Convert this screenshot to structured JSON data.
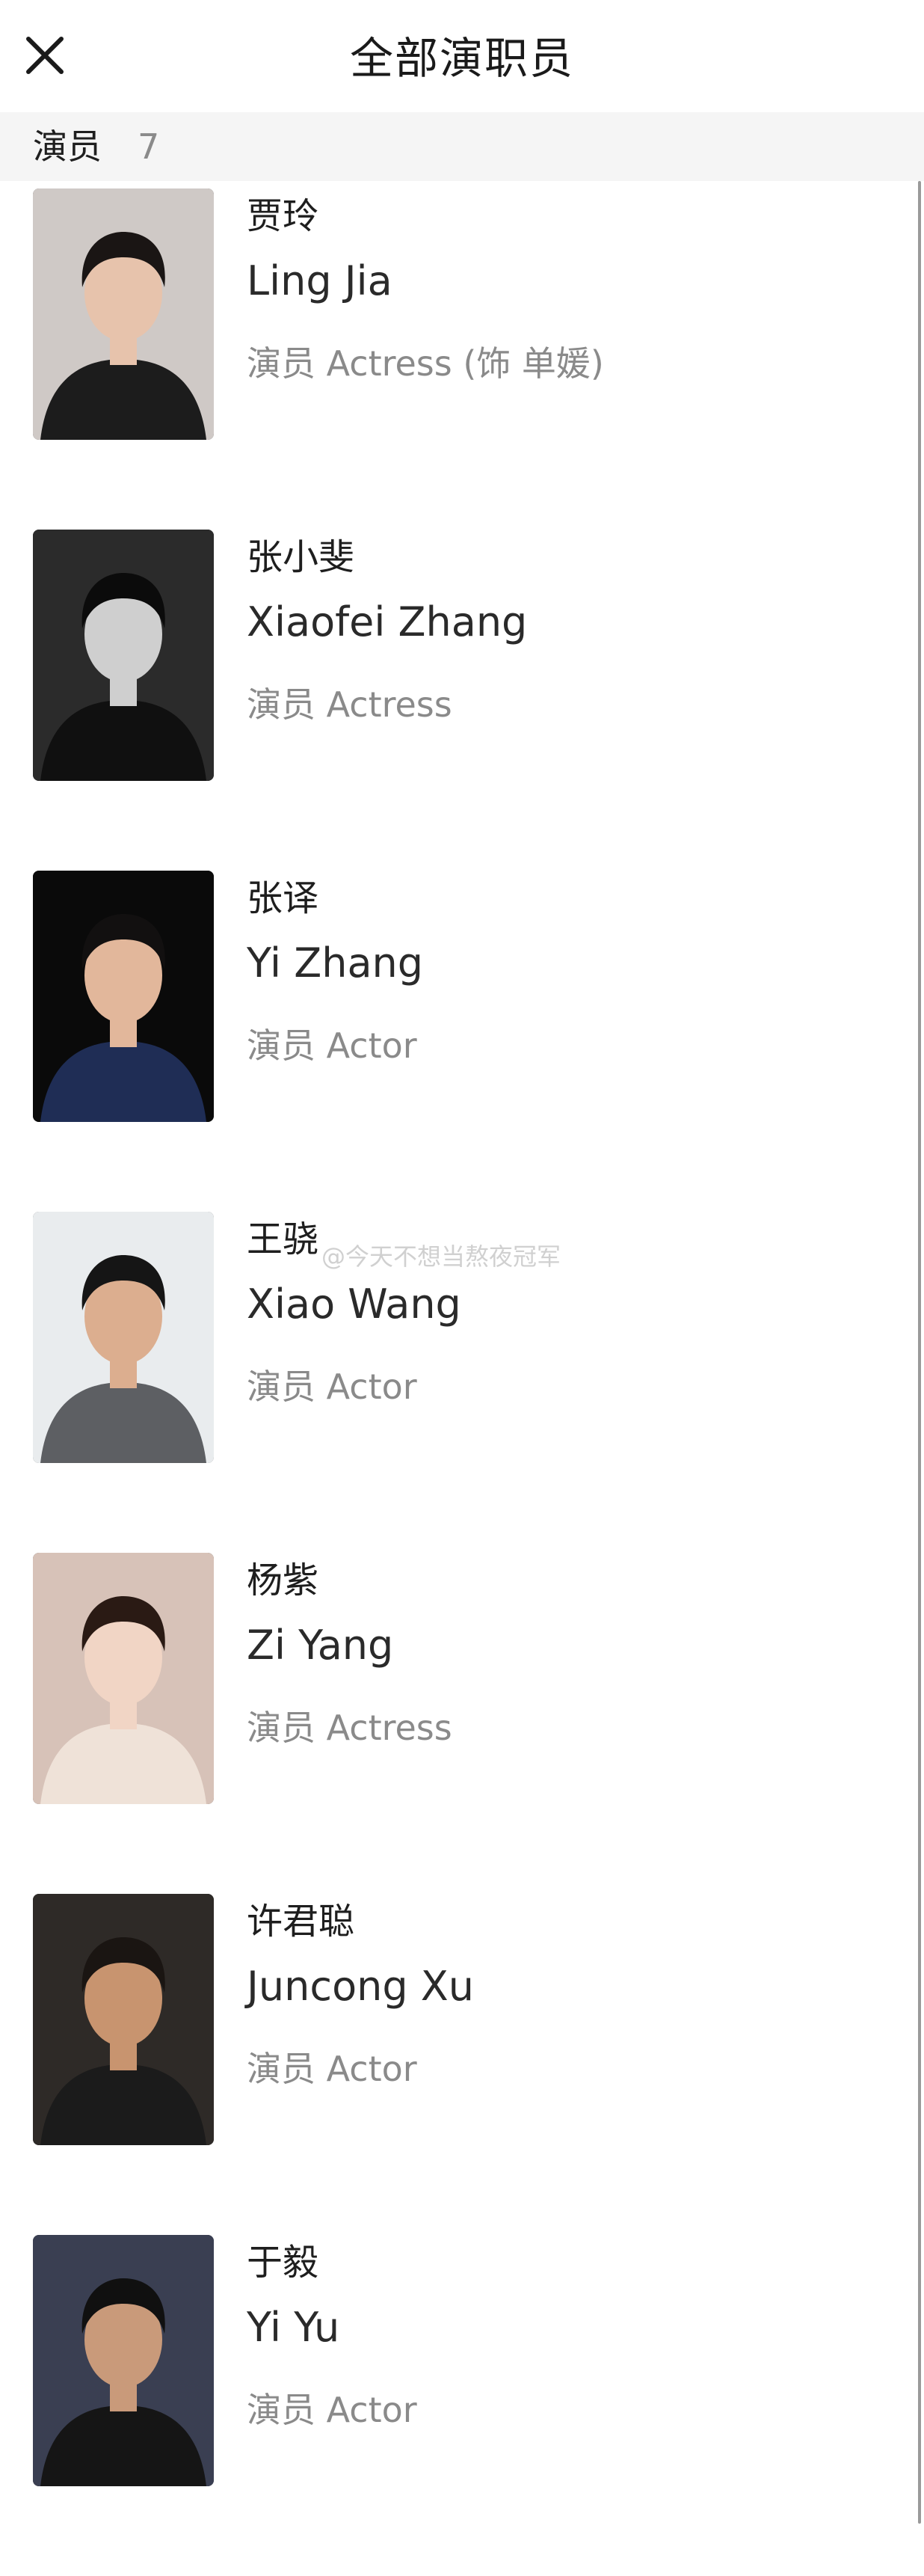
{
  "header": {
    "close_icon": "close-icon",
    "title": "全部演职员"
  },
  "section": {
    "label": "演员",
    "count": "7"
  },
  "cast": [
    {
      "cn": "贾玲",
      "en": "Ling Jia",
      "role": "演员 Actress (饰 单媛)",
      "bg": "#cfc9c6",
      "cloth": "#1c1c1c",
      "skin": "#e7c3ac",
      "hair": "#1a1514"
    },
    {
      "cn": "张小斐",
      "en": "Xiaofei Zhang",
      "role": "演员 Actress",
      "bg": "#2b2b2b",
      "cloth": "#101010",
      "skin": "#cfcfcf",
      "hair": "#0b0b0b"
    },
    {
      "cn": "张译",
      "en": "Yi Zhang",
      "role": "演员 Actor",
      "bg": "#0a0a0a",
      "cloth": "#1f2d55",
      "skin": "#e2b79b",
      "hair": "#121010"
    },
    {
      "cn": "王骁",
      "en": "Xiao Wang",
      "role": "演员 Actor",
      "bg": "#e9ecee",
      "cloth": "#5d5f63",
      "skin": "#dcae8f",
      "hair": "#151515"
    },
    {
      "cn": "杨紫",
      "en": "Zi Yang",
      "role": "演员 Actress",
      "bg": "#d7c2b8",
      "cloth": "#efe2d8",
      "skin": "#f1d5c5",
      "hair": "#2a1a14"
    },
    {
      "cn": "许君聪",
      "en": "Juncong Xu",
      "role": "演员 Actor",
      "bg": "#2e2a27",
      "cloth": "#1b1b1b",
      "skin": "#c8946f",
      "hair": "#1a1512"
    },
    {
      "cn": "于毅",
      "en": "Yi Yu",
      "role": "演员 Actor",
      "bg": "#3a3f52",
      "cloth": "#151515",
      "skin": "#c99a7a",
      "hair": "#101010"
    }
  ],
  "watermark": "@今天不想当熬夜冠军"
}
